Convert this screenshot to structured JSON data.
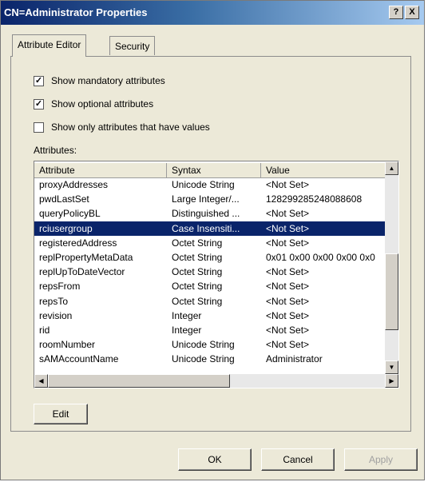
{
  "window": {
    "title": "CN=Administrator Properties",
    "help_label": "?",
    "close_label": "X"
  },
  "tabs": [
    {
      "label": "Attribute Editor",
      "active": true
    },
    {
      "label": "Security",
      "active": false
    }
  ],
  "options": [
    {
      "label": "Show mandatory attributes",
      "checked": true
    },
    {
      "label": "Show optional attributes",
      "checked": true
    },
    {
      "label": "Show only attributes that have values",
      "checked": false
    }
  ],
  "check_mark": "✓",
  "attributes_label": "Attributes:",
  "table": {
    "columns": [
      "Attribute",
      "Syntax",
      "Value"
    ],
    "rows": [
      {
        "attribute": "proxyAddresses",
        "syntax": "Unicode String",
        "value": "<Not Set>"
      },
      {
        "attribute": "pwdLastSet",
        "syntax": "Large Integer/...",
        "value": "128299285248088608"
      },
      {
        "attribute": "queryPolicyBL",
        "syntax": "Distinguished ...",
        "value": "<Not Set>"
      },
      {
        "attribute": "rciusergroup",
        "syntax": "Case Insensiti...",
        "value": "<Not Set>",
        "selected": true
      },
      {
        "attribute": "registeredAddress",
        "syntax": "Octet String",
        "value": "<Not Set>"
      },
      {
        "attribute": "replPropertyMetaData",
        "syntax": "Octet String",
        "value": "0x01 0x00 0x00 0x00 0x0"
      },
      {
        "attribute": "replUpToDateVector",
        "syntax": "Octet String",
        "value": "<Not Set>"
      },
      {
        "attribute": "repsFrom",
        "syntax": "Octet String",
        "value": "<Not Set>"
      },
      {
        "attribute": "repsTo",
        "syntax": "Octet String",
        "value": "<Not Set>"
      },
      {
        "attribute": "revision",
        "syntax": "Integer",
        "value": "<Not Set>"
      },
      {
        "attribute": "rid",
        "syntax": "Integer",
        "value": "<Not Set>"
      },
      {
        "attribute": "roomNumber",
        "syntax": "Unicode String",
        "value": "<Not Set>"
      },
      {
        "attribute": "sAMAccountName",
        "syntax": "Unicode String",
        "value": "Administrator"
      }
    ]
  },
  "scroll_icons": {
    "up": "▲",
    "down": "▼",
    "left": "◀",
    "right": "▶"
  },
  "buttons": {
    "edit": "Edit",
    "ok": "OK",
    "cancel": "Cancel",
    "apply": "Apply"
  }
}
